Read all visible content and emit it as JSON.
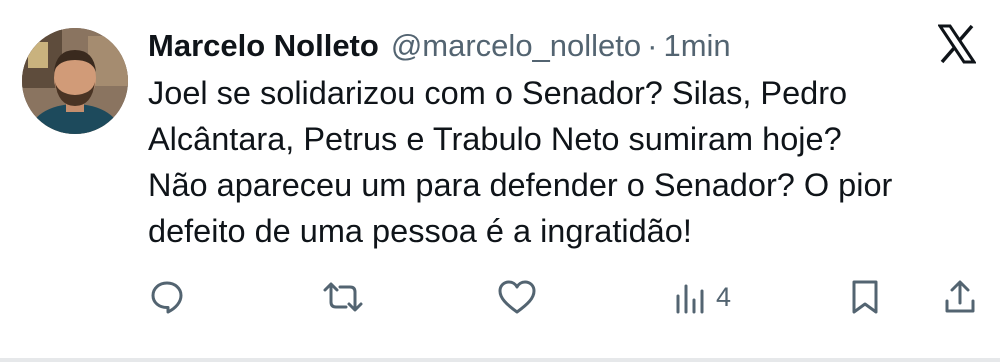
{
  "tweet": {
    "author_name": "Marcelo Nolleto",
    "handle": "@marcelo_nolleto",
    "separator": "·",
    "time": "1min",
    "text_lines": [
      "Joel se solidarizou com o Senador? Silas, Pedro",
      "Alcântara, Petrus e Trabulo Neto sumiram hoje?",
      "Não apareceu um para defender o Senador? O pior",
      "defeito de uma pessoa é a ingratidão!"
    ]
  },
  "actions": {
    "reply_icon": "reply-icon",
    "repost_icon": "repost-icon",
    "like_icon": "like-icon",
    "views_icon": "views-icon",
    "views_count": "4",
    "bookmark_icon": "bookmark-icon",
    "share_icon": "share-icon"
  },
  "colors": {
    "text": "#0f1419",
    "secondary": "#536471",
    "background": "#ffffff"
  }
}
